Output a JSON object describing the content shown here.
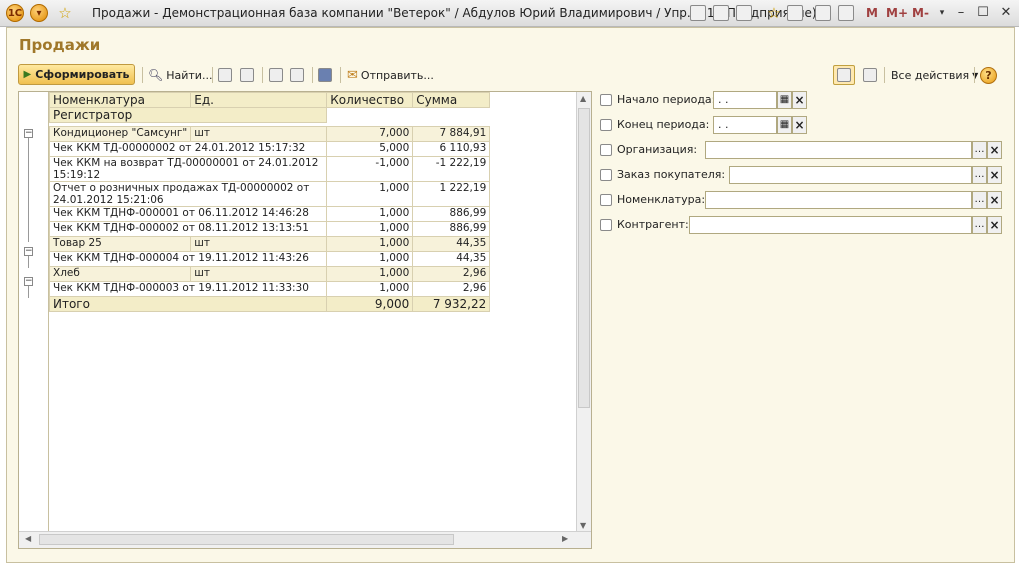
{
  "window": {
    "title": "Продажи - Демонстрационная база компании \"Ветерок\" / Абдулов Юрий Владимирович / Упр... (1С:Предприятие)",
    "m_buttons": [
      "M",
      "M+",
      "M-"
    ]
  },
  "page": {
    "title": "Продажи"
  },
  "toolbar": {
    "generate_label": "Сформировать",
    "find_label": "Найти...",
    "send_label": "Отправить...",
    "all_actions_label": "Все действия",
    "help_label": "?"
  },
  "report": {
    "headers": {
      "nomenclature": "Номенклатура",
      "unit": "Ед.",
      "quantity": "Количество",
      "sum": "Сумма",
      "registrar": "Регистратор"
    },
    "rows": [
      {
        "kind": "group",
        "name": "Кондиционер \"Самсунг\"",
        "unit": "шт",
        "qty": "7,000",
        "sum": "7 884,91"
      },
      {
        "kind": "detail",
        "name": "Чек ККМ ТД-00000002 от 24.01.2012 15:17:32",
        "qty": "5,000",
        "sum": "6 110,93"
      },
      {
        "kind": "detail2",
        "name": "Чек ККМ на возврат ТД-00000001 от 24.01.2012",
        "name2": "15:19:12",
        "qty": "-1,000",
        "sum": "-1 222,19"
      },
      {
        "kind": "detail2",
        "name": "Отчет о розничных продажах ТД-00000002 от",
        "name2": "24.01.2012 15:21:06",
        "qty": "1,000",
        "sum": "1 222,19"
      },
      {
        "kind": "detail",
        "name": "Чек ККМ ТДНФ-000001 от 06.11.2012 14:46:28",
        "qty": "1,000",
        "sum": "886,99"
      },
      {
        "kind": "detail",
        "name": "Чек ККМ ТДНФ-000002 от 08.11.2012 13:13:51",
        "qty": "1,000",
        "sum": "886,99"
      },
      {
        "kind": "group",
        "name": "Товар 25",
        "unit": "шт",
        "qty": "1,000",
        "sum": "44,35"
      },
      {
        "kind": "detail",
        "name": "Чек ККМ ТДНФ-000004 от 19.11.2012 11:43:26",
        "qty": "1,000",
        "sum": "44,35"
      },
      {
        "kind": "group",
        "name": "Хлеб",
        "unit": "шт",
        "qty": "1,000",
        "sum": "2,96"
      },
      {
        "kind": "detail",
        "name": "Чек ККМ ТДНФ-000003 от 19.11.2012 11:33:30",
        "qty": "1,000",
        "sum": "2,96"
      }
    ],
    "total": {
      "label": "Итого",
      "qty": "9,000",
      "sum": "7 932,22"
    }
  },
  "filters": {
    "period_start": {
      "label": "Начало периода:",
      "value": ". ."
    },
    "period_end": {
      "label": "Конец периода:",
      "value": ". ."
    },
    "organization": {
      "label": "Организация:",
      "value": ""
    },
    "customer_order": {
      "label": "Заказ покупателя:",
      "value": ""
    },
    "nomenclature": {
      "label": "Номенклатура:",
      "value": ""
    },
    "counterparty": {
      "label": "Контрагент:",
      "value": ""
    }
  }
}
